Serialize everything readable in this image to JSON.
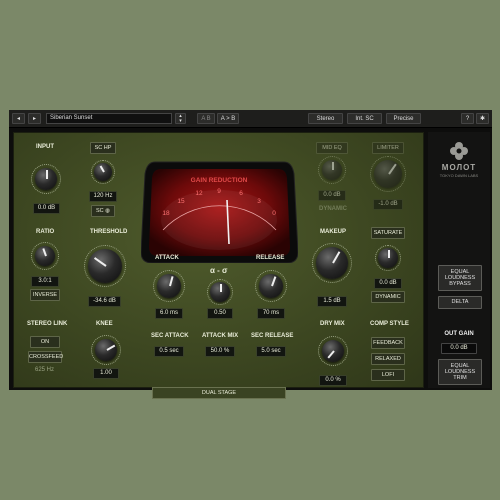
{
  "topbar": {
    "preset_name": "Siberian Sunset",
    "ab_a": "A B",
    "ab_copy": "A > B",
    "stereo": "Stereo",
    "sc_mode": "Int. SC",
    "precision": "Precise",
    "help": "?",
    "settings": "gear-icon"
  },
  "input": {
    "label": "INPUT",
    "value": "0.0 dB"
  },
  "sc_hp": {
    "label": "SC HP",
    "value": "120 Hz",
    "toggle": "SC ◍"
  },
  "ratio": {
    "label": "RATIO",
    "value": "3.0:1",
    "inverse": "INVERSE"
  },
  "threshold": {
    "label": "THRESHOLD",
    "value": "-34.6 dB"
  },
  "meter": {
    "title": "GAIN REDUCTION",
    "scale": [
      "18",
      "15",
      "12",
      "9",
      "6",
      "3",
      "0"
    ]
  },
  "attack": {
    "label": "ATTACK",
    "value": "6.0 ms"
  },
  "alpha": {
    "label": "α - σ",
    "value": "0.50"
  },
  "release": {
    "label": "RELEASE",
    "value": "70 ms"
  },
  "mid_eq": {
    "label": "MID EQ",
    "value": "0.0 dB",
    "mode": "DYNAMIC"
  },
  "limiter": {
    "label": "LIMITER",
    "value": "-1.0 dB"
  },
  "makeup": {
    "label": "MAKEUP",
    "value": "1.5 dB"
  },
  "saturate": {
    "label": "SATURATE",
    "value": "0.0 dB",
    "mode": "DYNAMIC"
  },
  "stereo_link": {
    "label": "STEREO LINK",
    "on": "ON",
    "crossfeed": "CROSSFEED",
    "freq": "625 Hz"
  },
  "knee": {
    "label": "KNEE",
    "value": "1.00"
  },
  "sec_attack": {
    "label": "SEC ATTACK",
    "value": "0.5 sec"
  },
  "attack_mix": {
    "label": "ATTACK MIX",
    "value": "50.0 %"
  },
  "sec_release": {
    "label": "SEC RELEASE",
    "value": "5.0 sec"
  },
  "dual_stage": "DUAL STAGE",
  "dry_mix": {
    "label": "DRY MIX",
    "value": "0.0 %"
  },
  "comp_style": {
    "label": "COMP STYLE",
    "options": [
      "FEEDBACK",
      "RELAXED",
      "LOFI"
    ]
  },
  "brand": {
    "name": "МОЛОТ",
    "maker": "TOKYO DAWN LABS"
  },
  "right": {
    "eq_bypass": "EQUAL LOUDNESS BYPASS",
    "delta": "DELTA",
    "out_gain_label": "OUT GAIN",
    "out_gain_value": "0.0 dB",
    "eq_trim": "EQUAL LOUDNESS TRIM"
  },
  "colors": {
    "background": "#7b8868",
    "panel": "#3d4721",
    "meter_red": "#8a1010",
    "text": "#e9ecd8"
  }
}
